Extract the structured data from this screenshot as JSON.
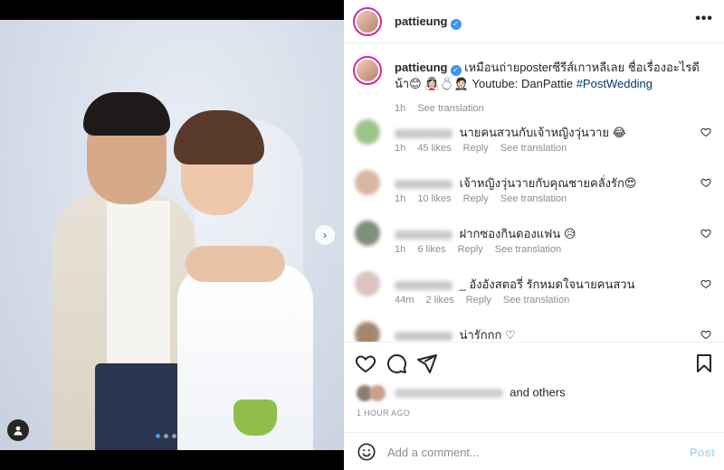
{
  "post": {
    "username": "pattieung",
    "more_label": "•••"
  },
  "media": {
    "next_arrow": "›",
    "carousel_dots": 4,
    "active_dot": 0
  },
  "caption": {
    "username": "pattieung",
    "text": "เหมือนถ่ายposterซีรีส์เกาหลีเลย ชื่อเรื่องอะไรดีน้า😊 👰🏻‍♀️💍🤵🏻 Youtube: DanPattie",
    "hashtag": "#PostWedding",
    "time": "1h",
    "translate": "See translation"
  },
  "comments": [
    {
      "text": "นายคนสวนกับเจ้าหญิงวุ่นวาย 😂",
      "time": "1h",
      "likes": "45 likes",
      "reply": "Reply",
      "translate": "See translation"
    },
    {
      "text": "เจ้าหญิงวุ่นวายกับคุณชายคลั่งรัก😍",
      "time": "1h",
      "likes": "10 likes",
      "reply": "Reply",
      "translate": "See translation"
    },
    {
      "text": "ฝากซองกินดองแฟน 😥",
      "time": "1h",
      "likes": "6 likes",
      "reply": "Reply",
      "translate": "See translation"
    },
    {
      "text": "_ อังอังสตอรี่ รักหมดใจนายคนสวน",
      "time": "44m",
      "likes": "2 likes",
      "reply": "Reply",
      "translate": "See translation"
    },
    {
      "text": "น่ารักกก ♡",
      "time": "",
      "likes": "",
      "reply": "",
      "translate": ""
    }
  ],
  "liked_by": {
    "suffix": "and others"
  },
  "timeago": "1 HOUR AGO",
  "add_comment": {
    "placeholder": "Add a comment...",
    "post_label": "Post"
  },
  "icons": {
    "heart": "heart-icon",
    "comment": "comment-icon",
    "share": "share-icon",
    "save": "bookmark-icon",
    "emoji": "emoji-icon",
    "verified": "verified-badge-icon",
    "tag": "user-tag-icon"
  },
  "colors": {
    "verified_blue": "#3897f0",
    "link_blue": "#00376b",
    "post_disabled": "#b3dbff",
    "muted": "#8e8e8e",
    "active_dot": "#3d9df5"
  }
}
